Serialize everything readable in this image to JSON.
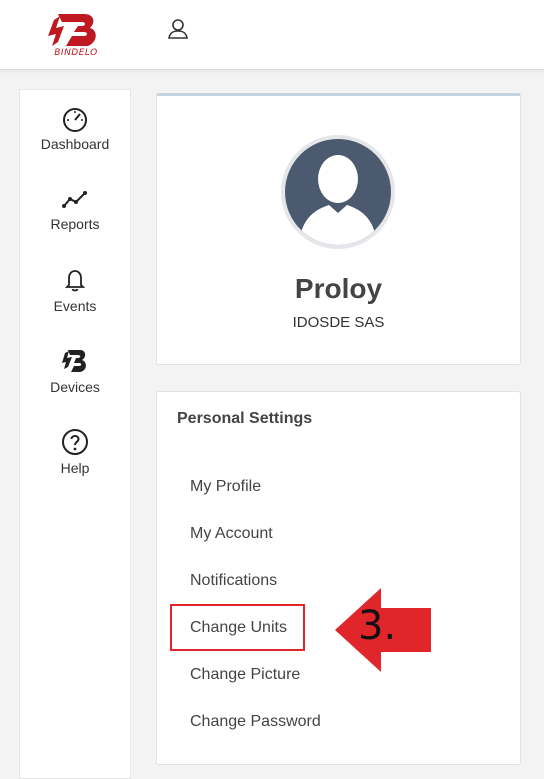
{
  "header": {
    "logo_text": "BINDELO",
    "user_icon": "user-icon"
  },
  "sidebar": {
    "items": [
      {
        "label": "Dashboard",
        "icon": "speedometer-icon"
      },
      {
        "label": "Reports",
        "icon": "line-chart-icon"
      },
      {
        "label": "Events",
        "icon": "bell-icon"
      },
      {
        "label": "Devices",
        "icon": "bindelo-b-icon"
      },
      {
        "label": "Help",
        "icon": "help-circle-icon"
      }
    ]
  },
  "profile": {
    "name": "Proloy",
    "company": "IDOSDE SAS"
  },
  "settings": {
    "title": "Personal Settings",
    "links": [
      "My Profile",
      "My Account",
      "Notifications",
      "Change Units",
      "Change Picture",
      "Change Password"
    ]
  },
  "annotation": {
    "step_label": "3."
  },
  "colors": {
    "brand_red": "#c01820",
    "highlight_red": "#e0262b",
    "avatar_bg": "#4b5a6e"
  }
}
